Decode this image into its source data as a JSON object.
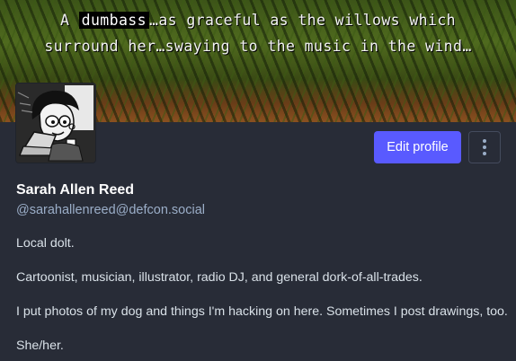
{
  "header": {
    "banner_line1_pre": "A ",
    "banner_line1_highlight": "dumbass",
    "banner_line1_post": "…as graceful as the willows which",
    "banner_line2": "surround her…swaying to the music in the wind…"
  },
  "actions": {
    "edit_profile_label": "Edit profile"
  },
  "profile": {
    "display_name": "Sarah Allen Reed",
    "handle": "@sarahallenreed@defcon.social",
    "bio": [
      "Local dolt.",
      "Cartoonist, musician, illustrator, radio DJ, and general dork-of-all-trades.",
      "I put photos of my dog and things I'm hacking on here. Sometimes I post drawings, too.",
      "She/her."
    ]
  },
  "colors": {
    "background": "#282c37",
    "accent": "#595aff",
    "secondary_text": "#9baec8",
    "body_text": "#d9e1e8"
  },
  "icons": {
    "menu": "kebab-menu-icon"
  }
}
